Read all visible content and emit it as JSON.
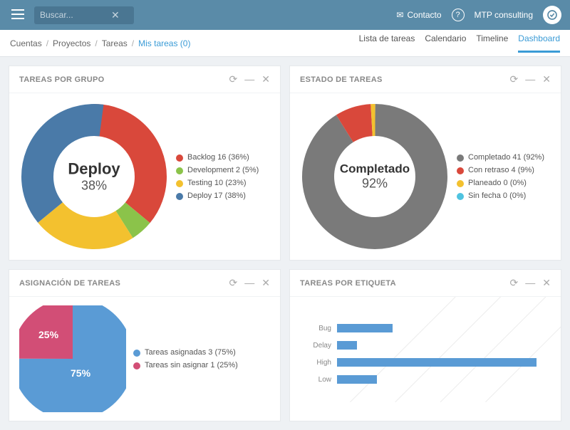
{
  "header": {
    "search_placeholder": "Buscar...",
    "contact": "Contacto",
    "org": "MTP consulting"
  },
  "breadcrumb": {
    "0": "Cuentas",
    "1": "Proyectos",
    "2": "Tareas",
    "3": "Mis tareas (0)"
  },
  "tabs": {
    "0": "Lista de tareas",
    "1": "Calendario",
    "2": "Timeline",
    "3": "Dashboard"
  },
  "cards": {
    "grupo": {
      "title": "TAREAS POR GRUPO",
      "center_label": "Deploy",
      "center_value": "38%",
      "legend": {
        "0": "Backlog 16 (36%)",
        "1": "Development 2 (5%)",
        "2": "Testing 10 (23%)",
        "3": "Deploy 17 (38%)"
      }
    },
    "estado": {
      "title": "ESTADO DE TAREAS",
      "center_label": "Completado",
      "center_value": "92%",
      "legend": {
        "0": "Completado 41 (92%)",
        "1": "Con retraso 4 (9%)",
        "2": "Planeado 0 (0%)",
        "3": "Sin fecha 0 (0%)"
      }
    },
    "asignacion": {
      "title": "ASIGNACIÓN DE TAREAS",
      "label_a": "75%",
      "label_b": "25%",
      "legend": {
        "0": "Tareas asignadas 3 (75%)",
        "1": "Tareas sin asignar 1 (25%)"
      }
    },
    "etiqueta": {
      "title": "TAREAS POR ETIQUETA",
      "rows": {
        "0": {
          "label": "Bug"
        },
        "1": {
          "label": "Delay"
        },
        "2": {
          "label": "High"
        },
        "3": {
          "label": "Low"
        }
      }
    }
  },
  "colors": {
    "red": "#d9483b",
    "green": "#8bc34a",
    "yellow": "#f3c12f",
    "blue": "#4a7aa8",
    "grey": "#7a7a7a",
    "pink": "#d24e76",
    "skyblue": "#5a9bd5",
    "teal": "#4fc3e0"
  },
  "chart_data": [
    {
      "type": "pie",
      "title": "TAREAS POR GRUPO",
      "series": [
        {
          "name": "Backlog",
          "value": 16,
          "percent": 36,
          "color": "#d9483b"
        },
        {
          "name": "Development",
          "value": 2,
          "percent": 5,
          "color": "#8bc34a"
        },
        {
          "name": "Testing",
          "value": 10,
          "percent": 23,
          "color": "#f3c12f"
        },
        {
          "name": "Deploy",
          "value": 17,
          "percent": 38,
          "color": "#4a7aa8"
        }
      ],
      "highlight": {
        "label": "Deploy",
        "percent": 38
      }
    },
    {
      "type": "pie",
      "title": "ESTADO DE TAREAS",
      "series": [
        {
          "name": "Completado",
          "value": 41,
          "percent": 92,
          "color": "#7a7a7a"
        },
        {
          "name": "Con retraso",
          "value": 4,
          "percent": 9,
          "color": "#d9483b"
        },
        {
          "name": "Planeado",
          "value": 0,
          "percent": 0,
          "color": "#f3c12f"
        },
        {
          "name": "Sin fecha",
          "value": 0,
          "percent": 0,
          "color": "#4fc3e0"
        }
      ],
      "highlight": {
        "label": "Completado",
        "percent": 92
      }
    },
    {
      "type": "pie",
      "title": "ASIGNACIÓN DE TAREAS",
      "series": [
        {
          "name": "Tareas asignadas",
          "value": 3,
          "percent": 75,
          "color": "#5a9bd5"
        },
        {
          "name": "Tareas sin asignar",
          "value": 1,
          "percent": 25,
          "color": "#d24e76"
        }
      ]
    },
    {
      "type": "bar",
      "title": "TAREAS POR ETIQUETA",
      "categories": [
        "Bug",
        "Delay",
        "High",
        "Low"
      ],
      "values": [
        28,
        10,
        100,
        20
      ],
      "xlabel": "",
      "ylabel": "",
      "ylim": [
        0,
        100
      ]
    }
  ]
}
